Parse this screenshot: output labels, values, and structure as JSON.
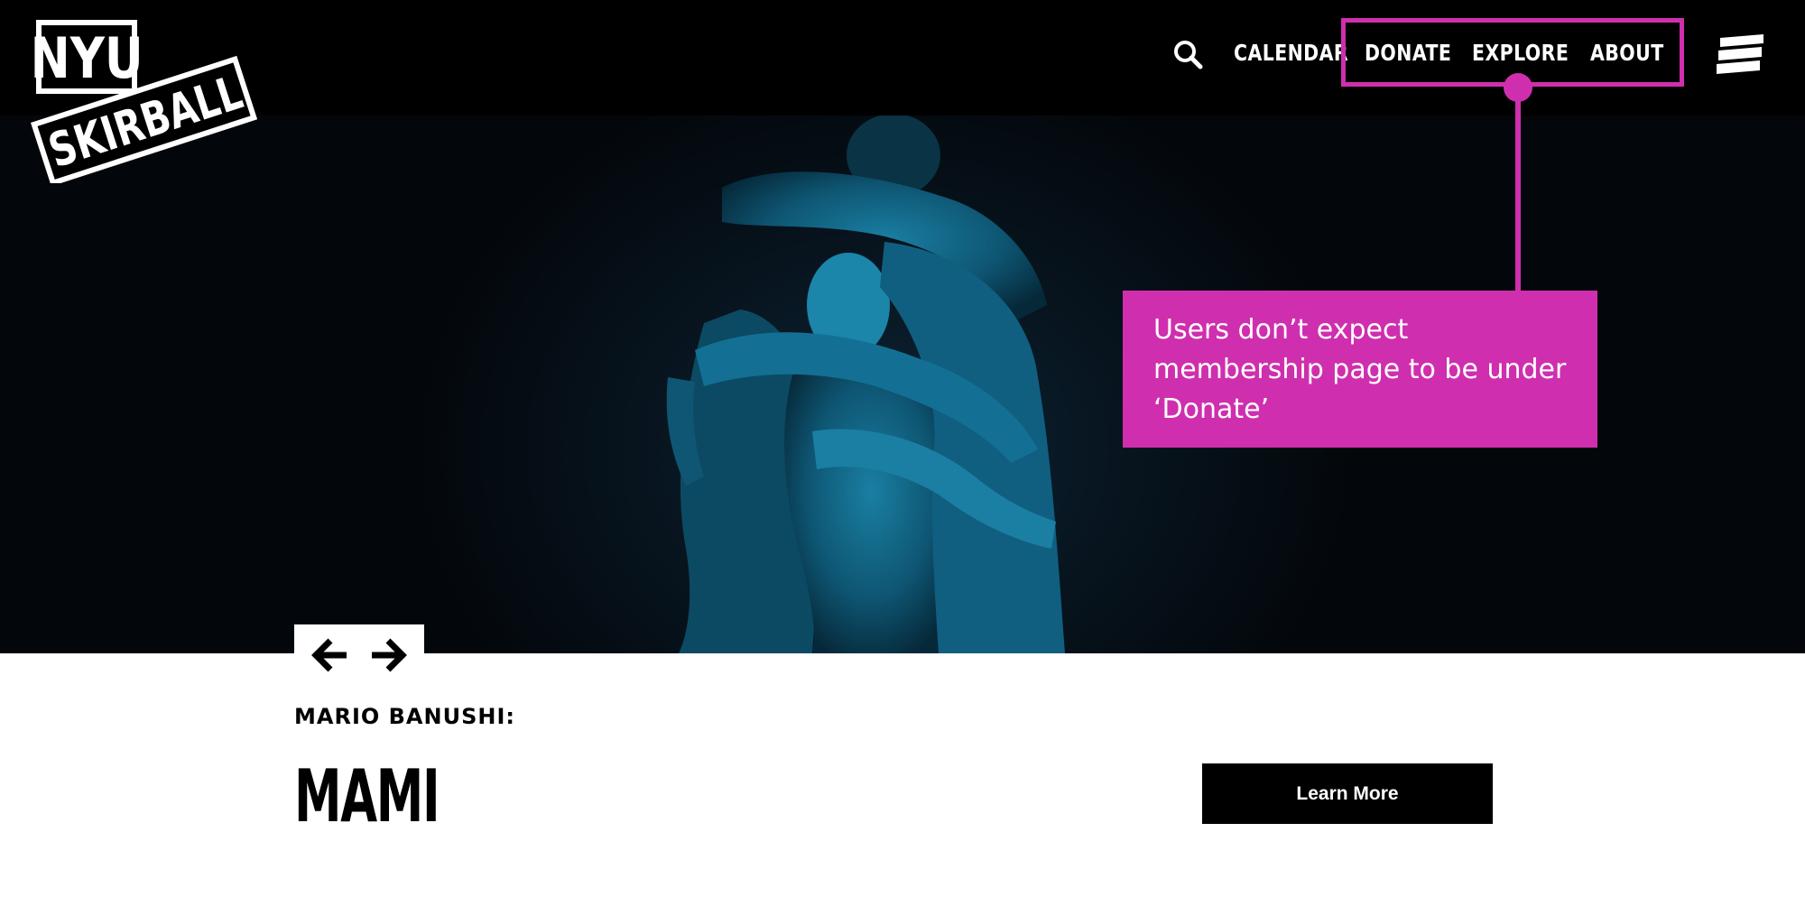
{
  "header": {
    "logo_text": [
      "NYU",
      "SKIRBALL"
    ],
    "nav": {
      "calendar": "CALENDAR",
      "donate": "DONATE",
      "explore": "EXPLORE",
      "about": "ABOUT"
    },
    "icons": {
      "search": "search-icon",
      "menu": "hamburger-menu-icon"
    }
  },
  "annotation": {
    "text": "Users don’t expect membership page to be under ‘Donate’",
    "color": "#cf2fae"
  },
  "hero": {
    "prev_icon": "arrow-left-icon",
    "next_icon": "arrow-right-icon"
  },
  "event": {
    "subtitle": "MARIO BANUSHI:",
    "title": "MAMI",
    "cta_label": "Learn More"
  },
  "colors": {
    "header_bg": "#000000",
    "accent": "#cf2fae",
    "hero_tint": "#0b6a8a"
  }
}
